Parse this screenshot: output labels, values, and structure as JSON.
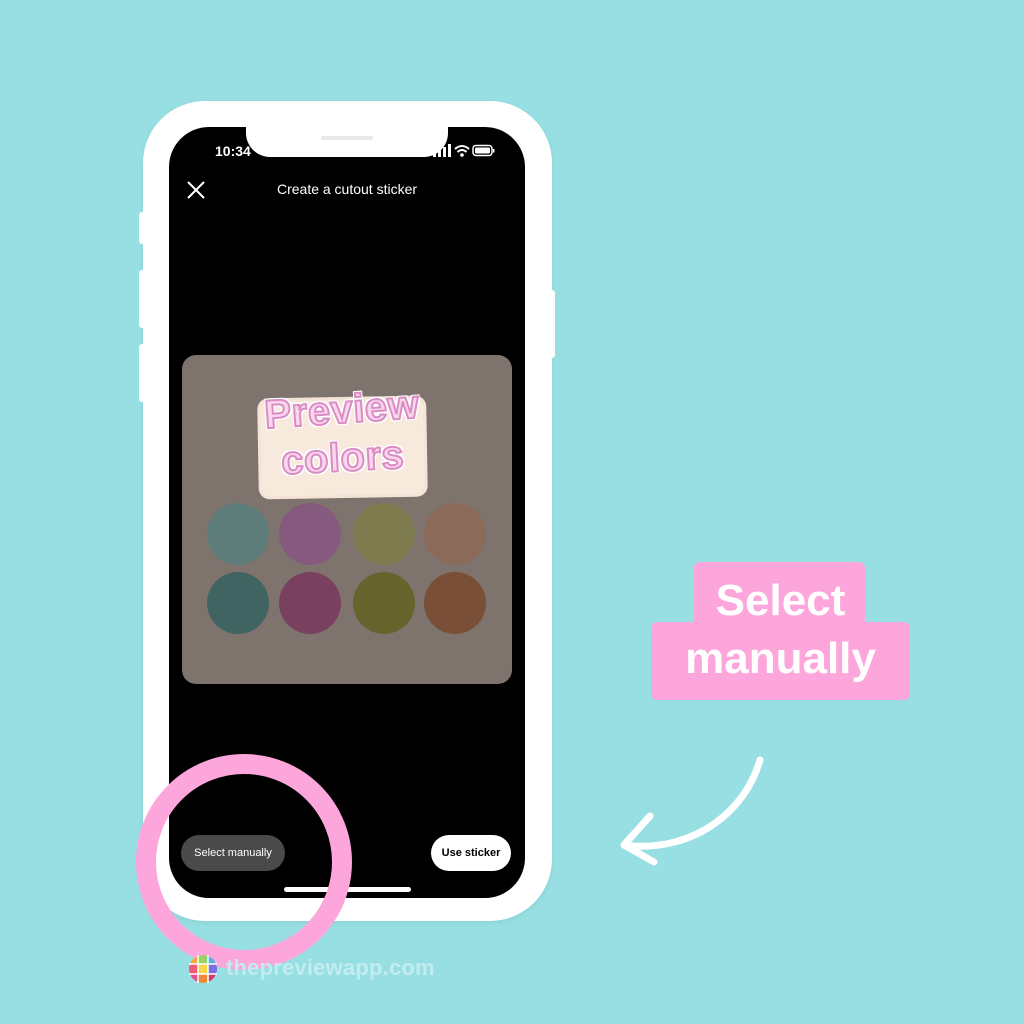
{
  "phone": {
    "status_time": "10:34",
    "title": "Create a cutout sticker",
    "sticker_text": [
      "Preview",
      "colors"
    ],
    "swatch_colors": [
      "#5e7c79",
      "#865a7f",
      "#7d7b4d",
      "#8c6a59",
      "#3f6462",
      "#79405f",
      "#67632c",
      "#7a4f38"
    ],
    "select_manually_label": "Select manually",
    "use_sticker_label": "Use sticker"
  },
  "callout": {
    "line1": "Select",
    "line2": "manually"
  },
  "footer": {
    "brand": "thepreviewapp.com"
  },
  "colors": {
    "background": "#97dfe2",
    "accent_pink": "#fca6db",
    "card": "#7e736d",
    "button_dark": "#4a4a4a"
  },
  "icons": [
    "close-icon",
    "signal-icon",
    "wifi-icon",
    "battery-icon",
    "arrow-icon",
    "brand-logo-icon"
  ]
}
